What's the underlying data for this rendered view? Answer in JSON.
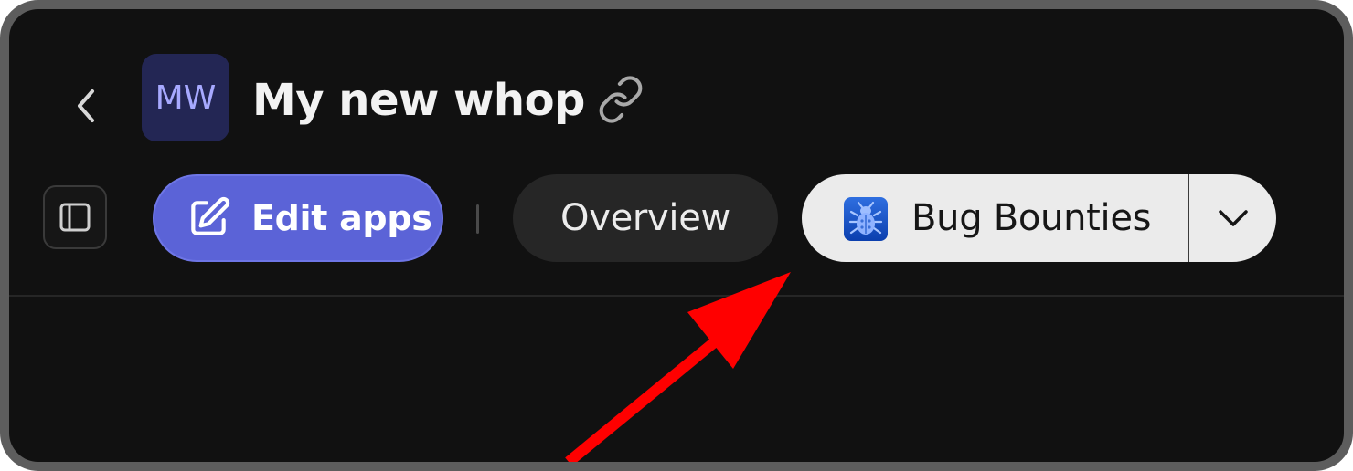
{
  "header": {
    "avatar_initials": "MW",
    "title": "My new whop"
  },
  "toolbar": {
    "edit_label": "Edit apps",
    "overview_label": "Overview",
    "bounties_label": "Bug Bounties"
  },
  "icons": {
    "back": "chevron-left-icon",
    "link": "link-icon",
    "sidebar": "sidebar-toggle-icon",
    "edit": "edit-icon",
    "bug": "bug-icon",
    "dropdown": "chevron-down-icon"
  },
  "colors": {
    "background": "#111111",
    "accent": "#5b63d7",
    "avatar_bg": "#232654",
    "avatar_text": "#a7a9ff",
    "annotation_arrow": "#ff0000"
  }
}
